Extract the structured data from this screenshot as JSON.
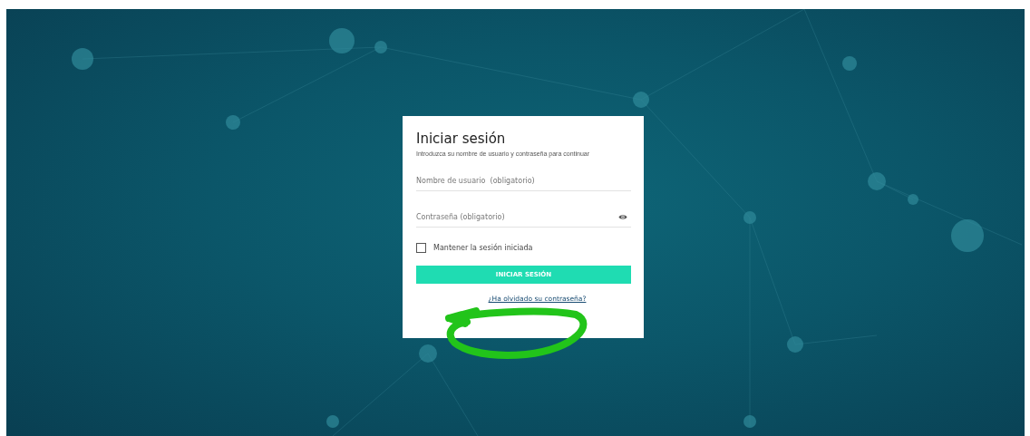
{
  "login": {
    "title": "Iniciar sesión",
    "subtitle": "Introduzca su nombre de usuario y contraseña para continuar",
    "fields": [
      {
        "kind": "text",
        "placeholder": "Nombre de usuario  (obligatorio)"
      },
      {
        "kind": "password",
        "placeholder": "Contraseña (obligatorio)"
      }
    ],
    "remember": {
      "label": "Mantener la sesión iniciada",
      "checked": false
    },
    "submit": "INICIAR SESIÓN",
    "forgot_link": "¿Ha olvidado su contraseña?"
  }
}
